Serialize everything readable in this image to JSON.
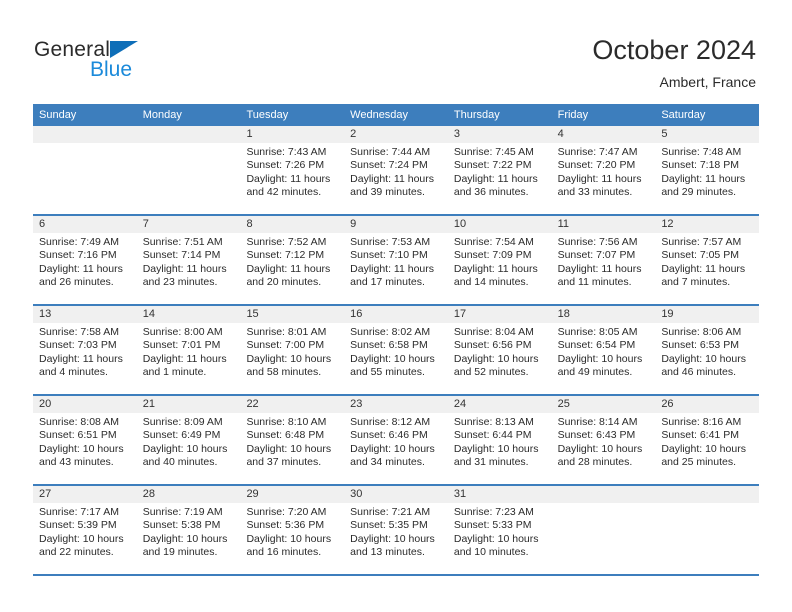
{
  "brand": {
    "name_dark": "General",
    "name_blue": "Blue",
    "triangle_icon": "triangle-icon",
    "color_dark": "#2b2b2b",
    "color_blue": "#1b8ada",
    "color_triangle": "#0e6eb8"
  },
  "header": {
    "title": "October 2024",
    "subtitle": "Ambert, France"
  },
  "theme": {
    "header_bg": "#3d7ebd",
    "header_text": "#ffffff",
    "daynum_bg": "#f0f0f0",
    "cell_bg": "#ffffff",
    "text": "#2b2b2b"
  },
  "calendar": {
    "weekday_headers": [
      "Sunday",
      "Monday",
      "Tuesday",
      "Wednesday",
      "Thursday",
      "Friday",
      "Saturday"
    ],
    "weeks": [
      [
        {
          "day": "",
          "lines": []
        },
        {
          "day": "",
          "lines": []
        },
        {
          "day": "1",
          "lines": [
            "Sunrise: 7:43 AM",
            "Sunset: 7:26 PM",
            "Daylight: 11 hours",
            "and 42 minutes."
          ]
        },
        {
          "day": "2",
          "lines": [
            "Sunrise: 7:44 AM",
            "Sunset: 7:24 PM",
            "Daylight: 11 hours",
            "and 39 minutes."
          ]
        },
        {
          "day": "3",
          "lines": [
            "Sunrise: 7:45 AM",
            "Sunset: 7:22 PM",
            "Daylight: 11 hours",
            "and 36 minutes."
          ]
        },
        {
          "day": "4",
          "lines": [
            "Sunrise: 7:47 AM",
            "Sunset: 7:20 PM",
            "Daylight: 11 hours",
            "and 33 minutes."
          ]
        },
        {
          "day": "5",
          "lines": [
            "Sunrise: 7:48 AM",
            "Sunset: 7:18 PM",
            "Daylight: 11 hours",
            "and 29 minutes."
          ]
        }
      ],
      [
        {
          "day": "6",
          "lines": [
            "Sunrise: 7:49 AM",
            "Sunset: 7:16 PM",
            "Daylight: 11 hours",
            "and 26 minutes."
          ]
        },
        {
          "day": "7",
          "lines": [
            "Sunrise: 7:51 AM",
            "Sunset: 7:14 PM",
            "Daylight: 11 hours",
            "and 23 minutes."
          ]
        },
        {
          "day": "8",
          "lines": [
            "Sunrise: 7:52 AM",
            "Sunset: 7:12 PM",
            "Daylight: 11 hours",
            "and 20 minutes."
          ]
        },
        {
          "day": "9",
          "lines": [
            "Sunrise: 7:53 AM",
            "Sunset: 7:10 PM",
            "Daylight: 11 hours",
            "and 17 minutes."
          ]
        },
        {
          "day": "10",
          "lines": [
            "Sunrise: 7:54 AM",
            "Sunset: 7:09 PM",
            "Daylight: 11 hours",
            "and 14 minutes."
          ]
        },
        {
          "day": "11",
          "lines": [
            "Sunrise: 7:56 AM",
            "Sunset: 7:07 PM",
            "Daylight: 11 hours",
            "and 11 minutes."
          ]
        },
        {
          "day": "12",
          "lines": [
            "Sunrise: 7:57 AM",
            "Sunset: 7:05 PM",
            "Daylight: 11 hours",
            "and 7 minutes."
          ]
        }
      ],
      [
        {
          "day": "13",
          "lines": [
            "Sunrise: 7:58 AM",
            "Sunset: 7:03 PM",
            "Daylight: 11 hours",
            "and 4 minutes."
          ]
        },
        {
          "day": "14",
          "lines": [
            "Sunrise: 8:00 AM",
            "Sunset: 7:01 PM",
            "Daylight: 11 hours",
            "and 1 minute."
          ]
        },
        {
          "day": "15",
          "lines": [
            "Sunrise: 8:01 AM",
            "Sunset: 7:00 PM",
            "Daylight: 10 hours",
            "and 58 minutes."
          ]
        },
        {
          "day": "16",
          "lines": [
            "Sunrise: 8:02 AM",
            "Sunset: 6:58 PM",
            "Daylight: 10 hours",
            "and 55 minutes."
          ]
        },
        {
          "day": "17",
          "lines": [
            "Sunrise: 8:04 AM",
            "Sunset: 6:56 PM",
            "Daylight: 10 hours",
            "and 52 minutes."
          ]
        },
        {
          "day": "18",
          "lines": [
            "Sunrise: 8:05 AM",
            "Sunset: 6:54 PM",
            "Daylight: 10 hours",
            "and 49 minutes."
          ]
        },
        {
          "day": "19",
          "lines": [
            "Sunrise: 8:06 AM",
            "Sunset: 6:53 PM",
            "Daylight: 10 hours",
            "and 46 minutes."
          ]
        }
      ],
      [
        {
          "day": "20",
          "lines": [
            "Sunrise: 8:08 AM",
            "Sunset: 6:51 PM",
            "Daylight: 10 hours",
            "and 43 minutes."
          ]
        },
        {
          "day": "21",
          "lines": [
            "Sunrise: 8:09 AM",
            "Sunset: 6:49 PM",
            "Daylight: 10 hours",
            "and 40 minutes."
          ]
        },
        {
          "day": "22",
          "lines": [
            "Sunrise: 8:10 AM",
            "Sunset: 6:48 PM",
            "Daylight: 10 hours",
            "and 37 minutes."
          ]
        },
        {
          "day": "23",
          "lines": [
            "Sunrise: 8:12 AM",
            "Sunset: 6:46 PM",
            "Daylight: 10 hours",
            "and 34 minutes."
          ]
        },
        {
          "day": "24",
          "lines": [
            "Sunrise: 8:13 AM",
            "Sunset: 6:44 PM",
            "Daylight: 10 hours",
            "and 31 minutes."
          ]
        },
        {
          "day": "25",
          "lines": [
            "Sunrise: 8:14 AM",
            "Sunset: 6:43 PM",
            "Daylight: 10 hours",
            "and 28 minutes."
          ]
        },
        {
          "day": "26",
          "lines": [
            "Sunrise: 8:16 AM",
            "Sunset: 6:41 PM",
            "Daylight: 10 hours",
            "and 25 minutes."
          ]
        }
      ],
      [
        {
          "day": "27",
          "lines": [
            "Sunrise: 7:17 AM",
            "Sunset: 5:39 PM",
            "Daylight: 10 hours",
            "and 22 minutes."
          ]
        },
        {
          "day": "28",
          "lines": [
            "Sunrise: 7:19 AM",
            "Sunset: 5:38 PM",
            "Daylight: 10 hours",
            "and 19 minutes."
          ]
        },
        {
          "day": "29",
          "lines": [
            "Sunrise: 7:20 AM",
            "Sunset: 5:36 PM",
            "Daylight: 10 hours",
            "and 16 minutes."
          ]
        },
        {
          "day": "30",
          "lines": [
            "Sunrise: 7:21 AM",
            "Sunset: 5:35 PM",
            "Daylight: 10 hours",
            "and 13 minutes."
          ]
        },
        {
          "day": "31",
          "lines": [
            "Sunrise: 7:23 AM",
            "Sunset: 5:33 PM",
            "Daylight: 10 hours",
            "and 10 minutes."
          ]
        },
        {
          "day": "",
          "lines": []
        },
        {
          "day": "",
          "lines": []
        }
      ]
    ]
  }
}
